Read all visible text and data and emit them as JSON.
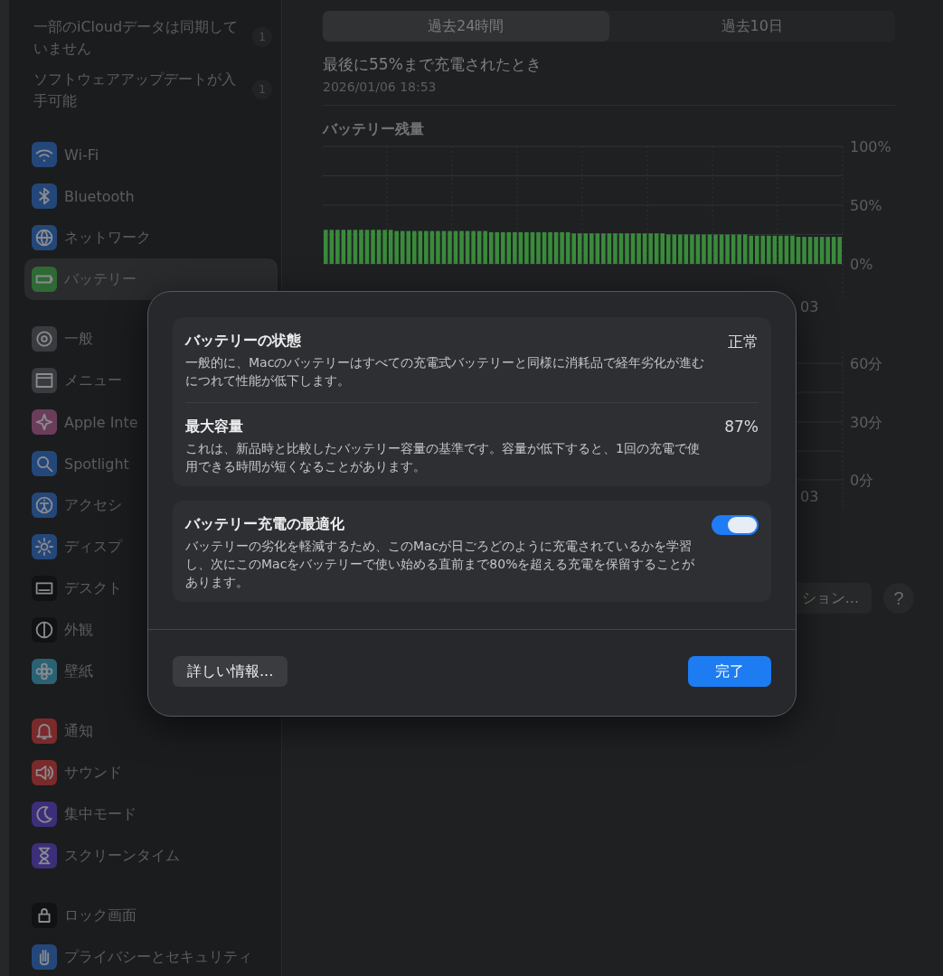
{
  "sidebar": {
    "notices": [
      {
        "text": "一部のiCloudデータは同期していません",
        "badge": "1"
      },
      {
        "text": "ソフトウェアアップデートが入手可能",
        "badge": "1"
      }
    ],
    "groups": [
      {
        "items": [
          {
            "label": "Wi-Fi",
            "color": "#24477a",
            "selected": false
          },
          {
            "label": "Bluetooth",
            "color": "#24477a",
            "selected": false
          },
          {
            "label": "ネットワーク",
            "color": "#24477a",
            "selected": false
          },
          {
            "label": "バッテリー",
            "color": "#2f6a34",
            "selected": true
          }
        ]
      },
      {
        "items": [
          {
            "label": "一般",
            "color": "#3a3b3e",
            "selected": false
          },
          {
            "label": "メニュー",
            "color": "#3a3b3e",
            "selected": false
          },
          {
            "label": "Apple Inte",
            "color": "#6a3d5a",
            "selected": false
          },
          {
            "label": "Spotlight",
            "color": "#24477a",
            "selected": false
          },
          {
            "label": "アクセシ",
            "color": "#24477a",
            "selected": false
          },
          {
            "label": "ディスプ",
            "color": "#24477a",
            "selected": false
          },
          {
            "label": "デスクト",
            "color": "#111214",
            "selected": false
          },
          {
            "label": "外観",
            "color": "#111214",
            "selected": false
          },
          {
            "label": "壁紙",
            "color": "#2a6274",
            "selected": false
          }
        ]
      },
      {
        "items": [
          {
            "label": "通知",
            "color": "#7a2a2a",
            "selected": false
          },
          {
            "label": "サウンド",
            "color": "#7a2a2a",
            "selected": false
          },
          {
            "label": "集中モード",
            "color": "#3d2e7a",
            "selected": false
          },
          {
            "label": "スクリーンタイム",
            "color": "#3d2e7a",
            "selected": false
          }
        ]
      },
      {
        "items": [
          {
            "label": "ロック画面",
            "color": "#111214",
            "selected": false
          },
          {
            "label": "プライバシーとセキュリティ",
            "color": "#24477a",
            "selected": false
          }
        ]
      }
    ]
  },
  "tabs": [
    {
      "label": "過去24時間",
      "selected": true
    },
    {
      "label": "過去10日",
      "selected": false
    }
  ],
  "last_charge": {
    "text": "最後に55%まで充電されたとき",
    "date": "2026/01/06 18:53"
  },
  "battery_chart": {
    "x_label_visible": "03",
    "chart_data": {
      "type": "bar",
      "title": "バッテリー残量",
      "ylim": [
        0,
        100
      ],
      "yticks": [
        {
          "value": 100,
          "label": "100%"
        },
        {
          "value": 50,
          "label": "50%"
        },
        {
          "value": 0,
          "label": "0%"
        }
      ],
      "values": [
        29,
        29,
        29,
        29,
        29,
        29,
        29,
        29,
        29,
        29,
        29,
        29,
        28,
        28,
        28,
        28,
        28,
        28,
        28,
        28,
        28,
        28,
        28,
        28,
        28,
        28,
        28,
        28,
        27,
        27,
        27,
        27,
        27,
        27,
        27,
        27,
        27,
        27,
        27,
        27,
        27,
        27,
        26,
        26,
        26,
        26,
        26,
        26,
        26,
        26,
        26,
        26,
        26,
        26,
        26,
        26,
        26,
        26,
        25,
        25,
        25,
        25,
        25,
        25,
        25,
        25,
        25,
        25,
        25,
        25,
        25,
        25,
        24,
        24,
        24,
        24,
        24,
        24,
        24,
        24,
        23,
        23,
        23,
        23,
        23,
        23,
        23,
        23
      ]
    }
  },
  "usage_chart": {
    "tick_labels": [
      "60分",
      "30分",
      "0分"
    ],
    "x_label_visible": "03"
  },
  "options_button": "ション...",
  "help_button": "?",
  "dialog": {
    "sections": [
      {
        "rows": [
          {
            "title": "バッテリーの状態",
            "description": "一般的に、Macのバッテリーはすべての充電式バッテリーと同様に消耗品で経年劣化が進むにつれて性能が低下します。",
            "kind": "value",
            "value": "正常"
          },
          {
            "title": "最大容量",
            "description": "これは、新品時と比較したバッテリー容量の基準です。容量が低下すると、1回の充電で使用できる時間が短くなることがあります。",
            "kind": "value",
            "value": "87%"
          }
        ]
      },
      {
        "rows": [
          {
            "title": "バッテリー充電の最適化",
            "description": "バッテリーの劣化を軽減するため、このMacが日ごろどのように充電されているかを学習し、次にこのMacをバッテリーで使い始める直前まで80%を超える充電を保留することがあります。",
            "kind": "toggle",
            "on": true
          }
        ]
      }
    ],
    "buttons": [
      {
        "label": "詳しい情報...",
        "kind": "secondary"
      },
      {
        "label": "完了",
        "kind": "primary"
      }
    ]
  }
}
